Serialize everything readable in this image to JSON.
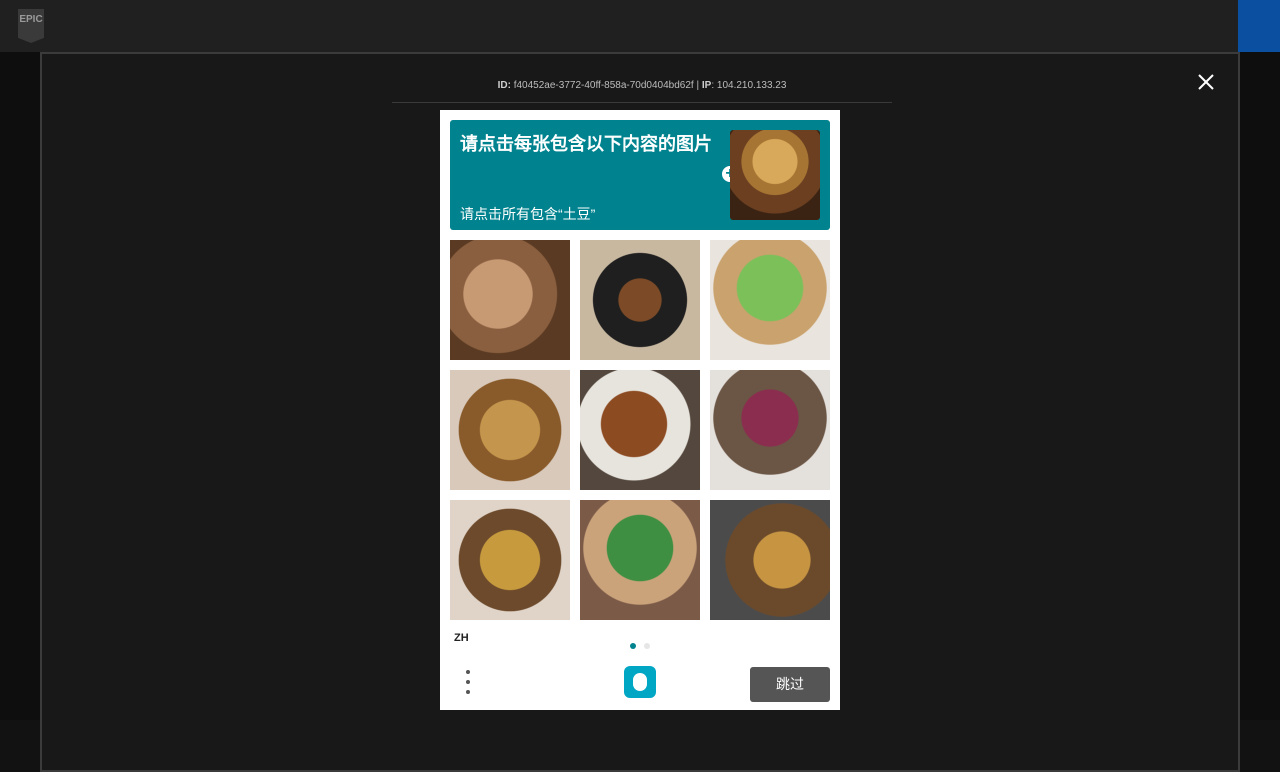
{
  "topbar": {
    "logo_text": "EPIC"
  },
  "modal": {
    "meta": {
      "id_prefix": "ID:",
      "id_value": "f40452ae-3772-40ff-858a-70d0404bd62f",
      "ip_prefix": "IP",
      "ip_value": "104.210.133.23",
      "separator": "|"
    }
  },
  "captcha": {
    "prompt_title": "请点击每张包含以下内容的图片",
    "prompt_subtitle": "请点击所有包含“土豆”",
    "language": "ZH",
    "submit_label": "跳过",
    "tiles": [
      {
        "name": "potatoes-basket",
        "selected": false
      },
      {
        "name": "roast-chicken",
        "selected": false
      },
      {
        "name": "cabbage-basket",
        "selected": false
      },
      {
        "name": "potatoes-wicker",
        "selected": false
      },
      {
        "name": "roast-chicken-plate",
        "selected": false
      },
      {
        "name": "onions-basket",
        "selected": false
      },
      {
        "name": "potatoes-bowl",
        "selected": false
      },
      {
        "name": "cabbage-bowl",
        "selected": false
      },
      {
        "name": "potatoes-woven",
        "selected": false
      }
    ],
    "pager": {
      "current": 1,
      "total": 2
    },
    "colors": {
      "accent": "#00838f",
      "submit_bg": "#555555"
    }
  }
}
